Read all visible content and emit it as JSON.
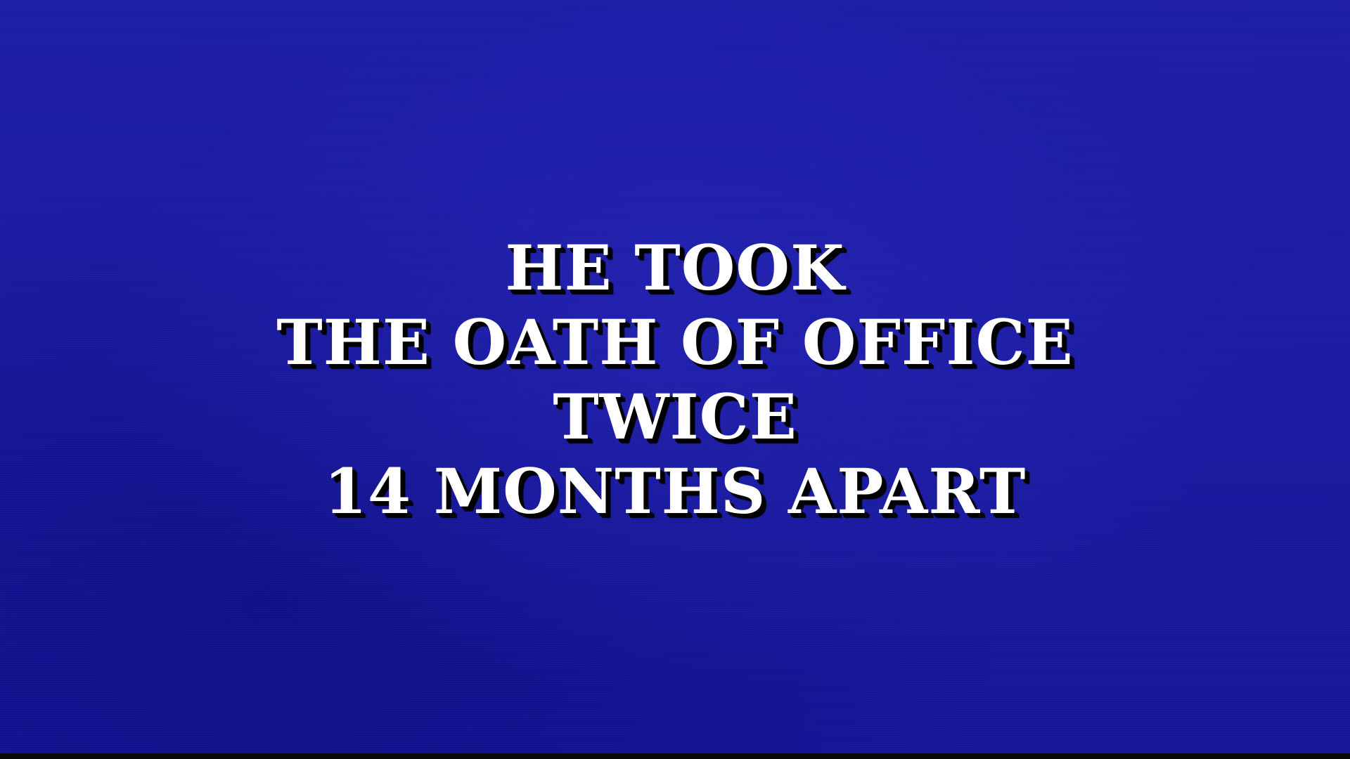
{
  "clue": {
    "lines": [
      "HE TOOK",
      "THE OATH OF OFFICE",
      "TWICE",
      "14 MONTHS APART"
    ]
  },
  "colors": {
    "background": "#1a1aa0",
    "text": "#ffffff",
    "shadow": "#000000"
  }
}
